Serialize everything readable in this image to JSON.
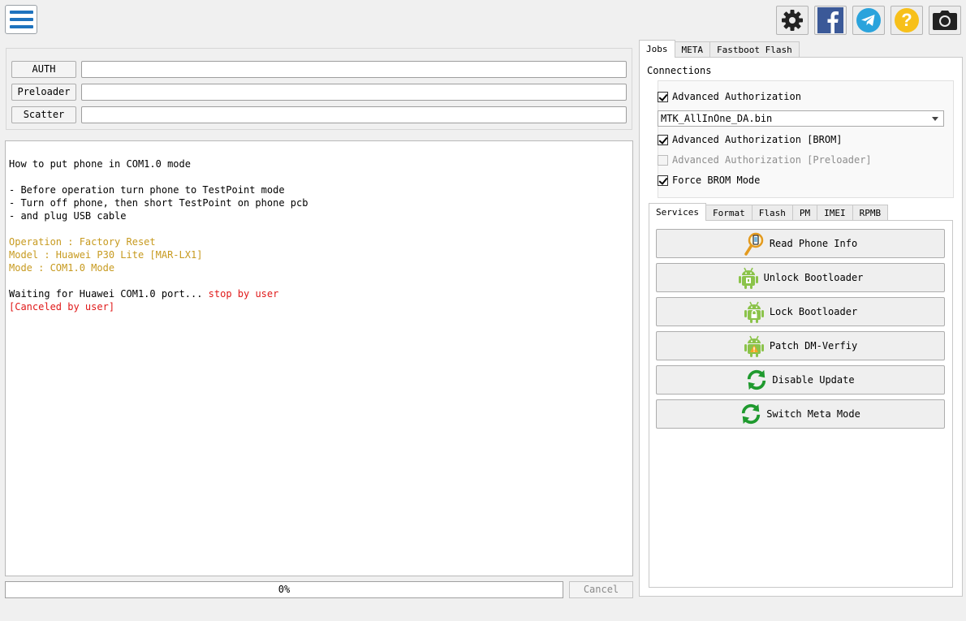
{
  "toolbar": {
    "icons": [
      "settings-icon",
      "facebook-icon",
      "telegram-icon",
      "help-icon",
      "camera-icon"
    ],
    "colors": {
      "menu": "#1e73be",
      "facebook": "#3b5998",
      "telegram": "#2aa3dc",
      "help": "#f7c01a"
    }
  },
  "inputs": {
    "auth_label": "AUTH",
    "preloader_label": "Preloader",
    "scatter_label": "Scatter",
    "auth_value": "",
    "preloader_value": "",
    "scatter_value": ""
  },
  "log": {
    "lines": [
      {
        "text": "How to put phone in COM1.0 mode"
      },
      {
        "text": ""
      },
      {
        "text": "- Before operation turn phone to TestPoint mode"
      },
      {
        "text": "- Turn off phone, then short TestPoint on phone pcb"
      },
      {
        "text": "- and plug USB cable"
      },
      {
        "text": ""
      },
      {
        "text": "Operation : Factory Reset",
        "color": "orange"
      },
      {
        "text": "Model : Huawei P30 Lite [MAR-LX1]",
        "color": "orange"
      },
      {
        "text": "Mode : COM1.0 Mode",
        "color": "orange"
      },
      {
        "text": ""
      },
      {
        "text": "Waiting for Huawei COM1.0 port... ",
        "suffix": "stop by user",
        "suffix_color": "red"
      },
      {
        "text": "[Canceled by user]",
        "color": "red"
      }
    ]
  },
  "progress": {
    "percent": 0,
    "label": "0%"
  },
  "cancel_label": "Cancel",
  "main_tabs": [
    {
      "label": "Jobs",
      "active": true
    },
    {
      "label": "META",
      "active": false
    },
    {
      "label": "Fastboot Flash",
      "active": false
    }
  ],
  "connections": {
    "title": "Connections",
    "advanced_auth": {
      "label": "Advanced Authorization",
      "checked": true
    },
    "da_file": "MTK_AllInOne_DA.bin",
    "advanced_auth_brom": {
      "label": "Advanced Authorization [BROM]",
      "checked": true
    },
    "advanced_auth_preloader": {
      "label": "Advanced Authorization [Preloader]",
      "checked": false,
      "disabled": true
    },
    "force_brom": {
      "label": "Force BROM Mode",
      "checked": true
    }
  },
  "sub_tabs": [
    {
      "label": "Services",
      "active": true
    },
    {
      "label": "Format",
      "active": false
    },
    {
      "label": "Flash",
      "active": false
    },
    {
      "label": "PM",
      "active": false
    },
    {
      "label": "IMEI",
      "active": false
    },
    {
      "label": "RPMB",
      "active": false
    }
  ],
  "services": [
    {
      "label": "Read Phone Info",
      "icon": "magnifier-phone-icon"
    },
    {
      "label": "Unlock Bootloader",
      "icon": "android-unlock-icon"
    },
    {
      "label": "Lock Bootloader",
      "icon": "android-lock-icon"
    },
    {
      "label": "Patch DM-Verfiy",
      "icon": "android-warning-icon"
    },
    {
      "label": "Disable Update",
      "icon": "refresh-icon"
    },
    {
      "label": "Switch Meta Mode",
      "icon": "refresh-icon"
    }
  ]
}
